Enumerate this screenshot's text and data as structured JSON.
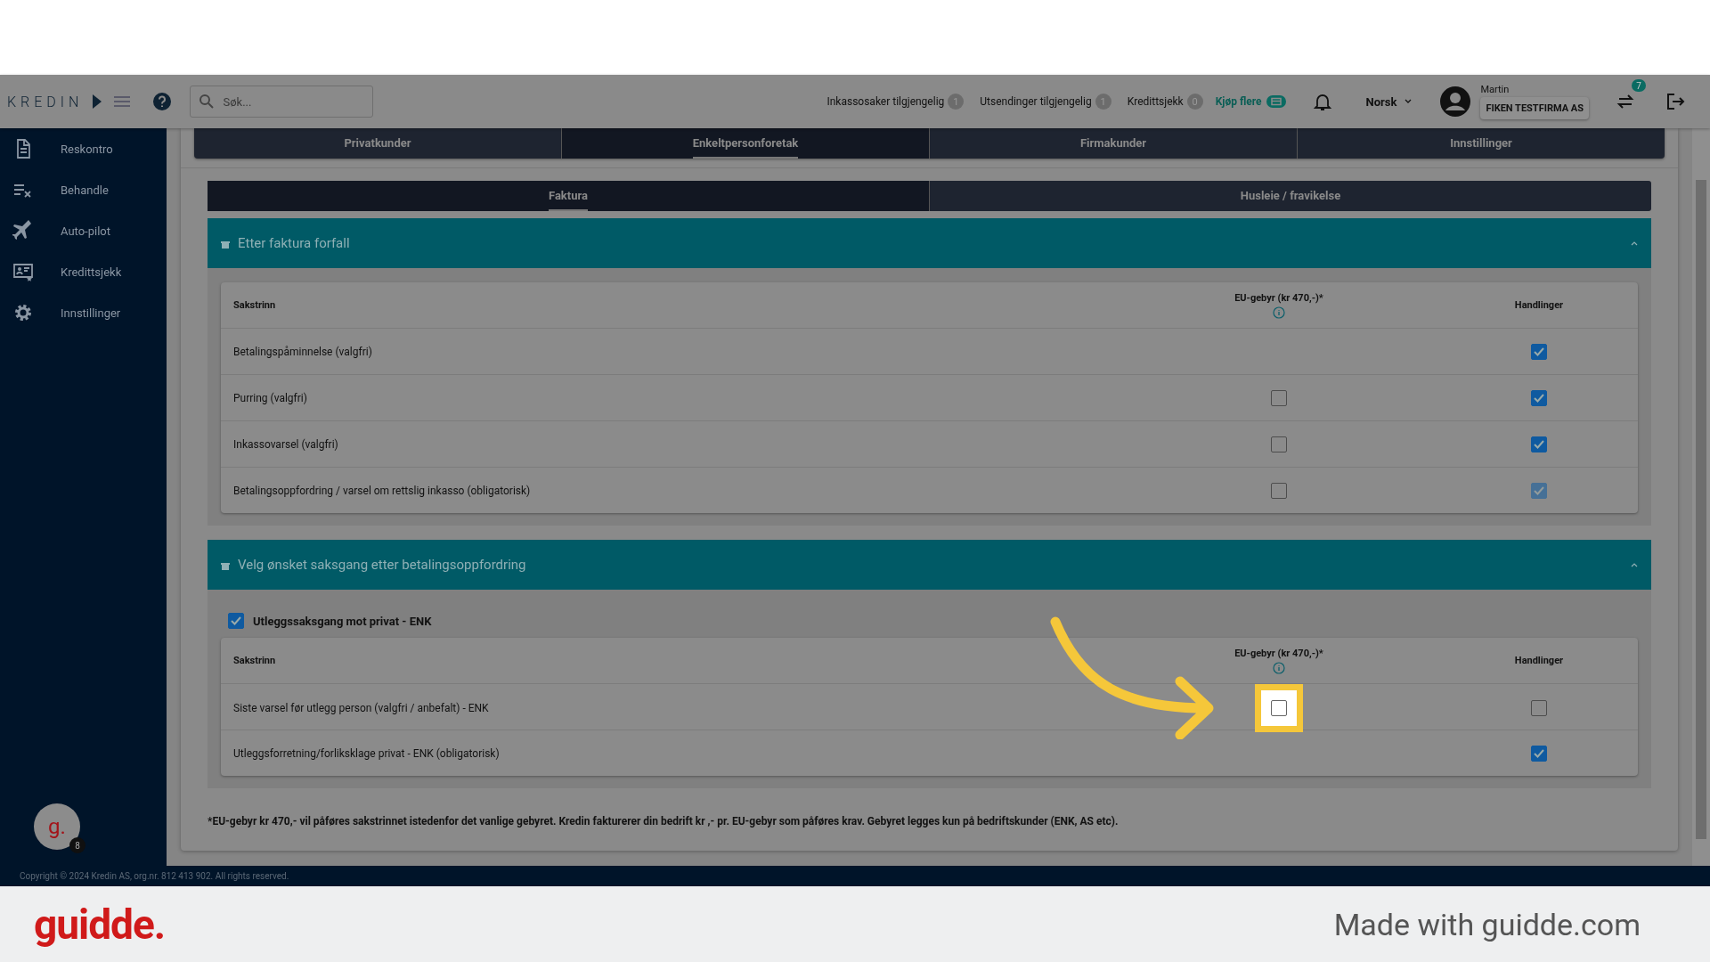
{
  "header": {
    "logo": "KREDIN",
    "search": {
      "placeholder": "Søk..."
    },
    "counters": [
      {
        "label": "Inkassosaker tilgjengelig",
        "count": "1"
      },
      {
        "label": "Utsendinger tilgjengelig",
        "count": "1"
      },
      {
        "label": "Kredittsjekk",
        "count": "0"
      }
    ],
    "buy_link": "Kjøp flere",
    "language": "Norsk",
    "user_name": "Martin",
    "company": "FIKEN TESTFIRMA AS",
    "transfer_badge": "7"
  },
  "sidebar": {
    "items": [
      {
        "label": "Reskontro"
      },
      {
        "label": "Behandle"
      },
      {
        "label": "Auto-pilot"
      },
      {
        "label": "Kredittsjekk"
      },
      {
        "label": "Innstillinger"
      }
    ],
    "avatar": {
      "letter": "g.",
      "badge": "8"
    }
  },
  "tabs": [
    {
      "label": "Privatkunder",
      "selected": false
    },
    {
      "label": "Enkeltpersonforetak",
      "selected": true
    },
    {
      "label": "Firmakunder",
      "selected": false
    },
    {
      "label": "Innstillinger",
      "selected": false
    }
  ],
  "subtabs": [
    {
      "label": "Faktura",
      "selected": true
    },
    {
      "label": "Husleie / fravikelse",
      "selected": false
    }
  ],
  "panels": [
    {
      "title": "Etter faktura forfall",
      "expanded": true,
      "columns": [
        "Sakstrinn",
        "EU-gebyr (kr 470,-)*",
        "Handlinger"
      ],
      "rows": [
        {
          "step": "Betalingspåminnelse (valgfri)",
          "actions": {
            "checked": true,
            "disabled": false
          }
        },
        {
          "step": "Purring (valgfri)",
          "eu_fee": {
            "checked": false,
            "highlighted": false
          },
          "actions": {
            "checked": true,
            "disabled": false
          }
        },
        {
          "step": "Inkassovarsel (valgfri)",
          "eu_fee": {
            "checked": false,
            "highlighted": false
          },
          "actions": {
            "checked": true,
            "disabled": false
          }
        },
        {
          "step": "Betalingsoppfordring / varsel om rettslig inkasso (obligatorisk)",
          "eu_fee": {
            "checked": false,
            "highlighted": false
          },
          "actions": {
            "checked": true,
            "disabled": true
          }
        }
      ]
    },
    {
      "title": "Velg ønsket saksgang etter betalingsoppfordring",
      "expanded": true,
      "option": {
        "label": "Utleggssaksgang mot privat - ENK",
        "checked": true
      },
      "columns": [
        "Sakstrinn",
        "EU-gebyr (kr 470,-)*",
        "Handlinger"
      ],
      "rows": [
        {
          "step": "Siste varsel før utlegg person (valgfri / anbefalt) - ENK",
          "eu_fee": {
            "checked": false,
            "highlighted": true
          },
          "actions": {
            "checked": false,
            "disabled": false
          }
        },
        {
          "step": "Utleggsforretning/forliksklage privat - ENK (obligatorisk)",
          "actions": {
            "checked": true,
            "disabled": false
          }
        }
      ]
    }
  ],
  "footnote": "*EU-gebyr kr 470,- vil påføres sakstrinnet istedenfor det vanlige gebyret. Kredin fakturerer din bedrift kr ,- pr. EU-gebyr som påføres krav. Gebyret legges kun på bedriftskunder (ENK, AS etc).",
  "copyright": "Copyright © 2024 Kredin AS, org.nr. 812 413 902. All rights reserved.",
  "branding": {
    "logo": "guidde.",
    "tagline": "Made with guidde.com"
  }
}
